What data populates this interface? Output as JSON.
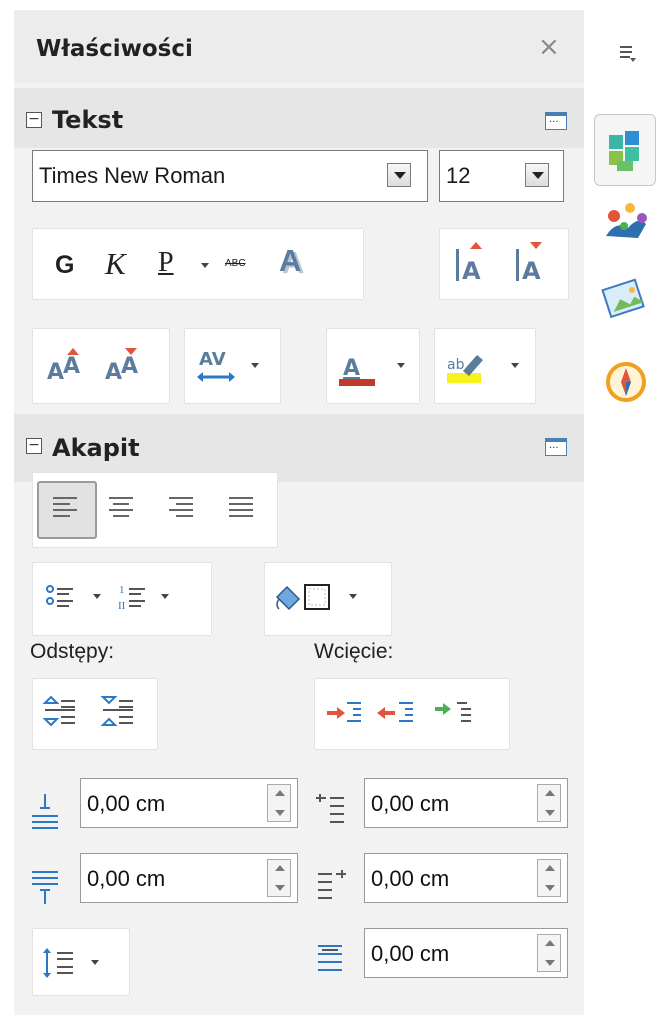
{
  "header": {
    "title": "Właściwości",
    "close": "×"
  },
  "text_section": {
    "title": "Tekst",
    "font_name": "Times New Roman",
    "font_size": "12",
    "bold": "G",
    "italic": "K",
    "underline": "P",
    "strike": "ABC",
    "shadow": "A"
  },
  "paragraph_section": {
    "title": "Akapit",
    "spacing_label": "Odstępy:",
    "indent_label": "Wcięcie:",
    "above_spacing": "0,00 cm",
    "below_spacing": "0,00 cm",
    "before_indent": "0,00 cm",
    "after_indent": "0,00 cm",
    "first_line_indent": "0,00 cm"
  },
  "colors": {
    "font_color": "#c0392b",
    "highlight": "#f7f21e",
    "accent": "#4a7fb5"
  },
  "sidebar": [
    "properties-icon",
    "styles-icon",
    "gallery-icon",
    "navigator-icon"
  ]
}
